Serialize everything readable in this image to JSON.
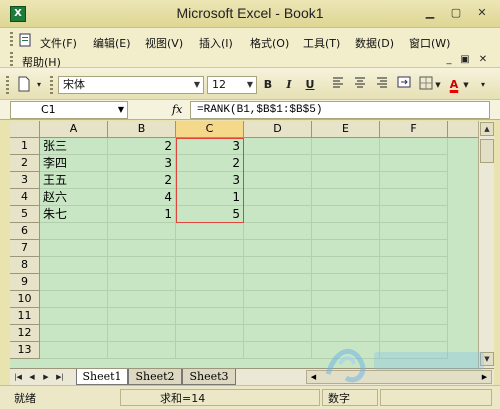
{
  "window": {
    "title": "Microsoft Excel - Book1",
    "app_icon": "excel-icon"
  },
  "menu": {
    "items": [
      "文件(F)",
      "编辑(E)",
      "视图(V)",
      "插入(I)",
      "格式(O)",
      "工具(T)",
      "数据(D)",
      "窗口(W)"
    ],
    "help": "帮助(H)"
  },
  "toolbar": {
    "font": "宋体",
    "size": "12",
    "bold": "B",
    "italic": "I",
    "underline": "U",
    "font_color_label": "A"
  },
  "formula_bar": {
    "name_box": "C1",
    "fx": "fx",
    "formula": "=RANK(B1,$B$1:$B$5)"
  },
  "grid": {
    "columns": [
      "A",
      "B",
      "C",
      "D",
      "E",
      "F"
    ],
    "rows": [
      "1",
      "2",
      "3",
      "4",
      "5",
      "6",
      "7",
      "8",
      "9",
      "10",
      "11",
      "12",
      "13"
    ],
    "cells": [
      [
        "张三",
        "2",
        "3"
      ],
      [
        "李四",
        "3",
        "2"
      ],
      [
        "王五",
        "2",
        "3"
      ],
      [
        "赵六",
        "4",
        "1"
      ],
      [
        "朱七",
        "1",
        "5"
      ]
    ]
  },
  "sheets": [
    "Sheet1",
    "Sheet2",
    "Sheet3"
  ],
  "status": {
    "ready": "就绪",
    "sum": "求和=14",
    "numlock": "数字"
  },
  "colors": {
    "grid_bg": "#c9e6c4",
    "selection": "#e0443a",
    "title_bg": "#e4dda3"
  }
}
